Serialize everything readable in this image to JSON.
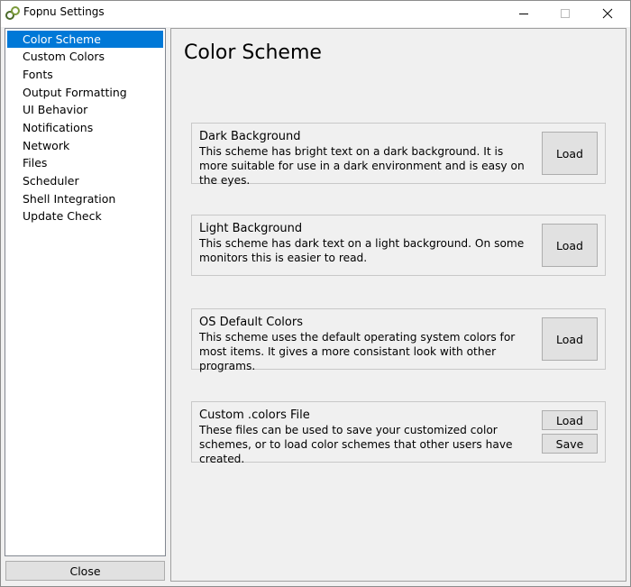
{
  "window": {
    "title": "Fopnu Settings",
    "controls": {
      "minimize": "minimize-icon",
      "maximize": "maximize-icon",
      "close": "close-icon"
    }
  },
  "sidebar": {
    "items": [
      {
        "label": "Color Scheme",
        "selected": true
      },
      {
        "label": "Custom Colors",
        "selected": false
      },
      {
        "label": "Fonts",
        "selected": false
      },
      {
        "label": "Output Formatting",
        "selected": false
      },
      {
        "label": "UI Behavior",
        "selected": false
      },
      {
        "label": "Notifications",
        "selected": false
      },
      {
        "label": "Network",
        "selected": false
      },
      {
        "label": "Files",
        "selected": false
      },
      {
        "label": "Scheduler",
        "selected": false
      },
      {
        "label": "Shell Integration",
        "selected": false
      },
      {
        "label": "Update Check",
        "selected": false
      }
    ],
    "close_label": "Close"
  },
  "main": {
    "title": "Color Scheme",
    "schemes": [
      {
        "title": "Dark Background",
        "description": "This scheme has bright text on a dark background.  It is more suitable for use in a dark environment and is easy on the eyes.",
        "load_label": "Load"
      },
      {
        "title": "Light Background",
        "description": "This scheme has dark text on a light background.  On some monitors this is easier to read.",
        "load_label": "Load"
      },
      {
        "title": "OS Default Colors",
        "description": "This scheme uses the default operating system colors for most items.  It gives a more consistant look with other programs.",
        "load_label": "Load"
      },
      {
        "title": "Custom .colors File",
        "description": "These files can be used to save your customized color schemes, or to load color schemes that other users have created.",
        "load_label": "Load",
        "save_label": "Save"
      }
    ]
  },
  "colors": {
    "selection": "#0078d7",
    "button_face": "#e1e1e1",
    "window_bg": "#f0f0f0"
  }
}
